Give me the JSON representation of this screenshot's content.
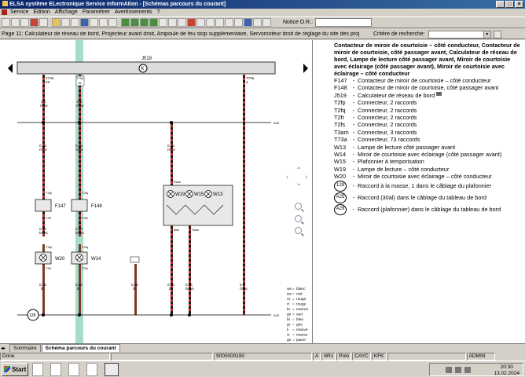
{
  "window": {
    "title": "ELSA système ELectronique Service informAtion - [Schémas parcours du courant]",
    "buttons": [
      "_",
      "□",
      "×"
    ]
  },
  "menu": [
    "Service",
    "Edition",
    "Affichage",
    "Paramétrer",
    "Avertissements",
    "?"
  ],
  "toolbar": {
    "notice_label": "Notice O.R.:",
    "notice_value": ""
  },
  "pagebar": {
    "description": "Page 11: Calculateur de réseau de bord, Projecteur avant droit, Ampoule de feu stop supplémentaire, Servomoteur droit de réglage du site des projecteurs, Éclaireur droit de",
    "search_label": "Critère de recherche:",
    "search_value": ""
  },
  "diagram": {
    "module": "J519",
    "module_symbol": "K",
    "pins": [
      "T73a 48",
      "T73a 15",
      "T73a 4"
    ],
    "pin_top": [
      "T73a",
      "T73a",
      "T73a"
    ],
    "pin_bottom": [
      "48",
      "15",
      "4"
    ],
    "wire_specs": [
      "1.0 rt/sw",
      "0.5 rt/sw",
      "0.35 rt/sw",
      "0.35 rt/sw",
      "0.35 rt/sw",
      "0.35 br/ws",
      "0.35 br/ws",
      "0.35 br",
      "0.35 br",
      "0.35 br",
      "0.35 br",
      "0.35 br/ws",
      "0.35 br/ws",
      "0.5 rt/sw"
    ],
    "wire_gauges": [
      "1.0",
      "0.5",
      "0.35",
      "0.35",
      "0.35",
      "0.35",
      "0.35",
      "0.35",
      "0.35",
      "0.35",
      "0.35",
      "0.35",
      "0.35",
      "0.5"
    ],
    "wire_colors": [
      "rt/sw",
      "rt/sw",
      "rt/sw",
      "rt/sw",
      "rt/sw",
      "br/ws",
      "br/ws",
      "br",
      "br",
      "br",
      "br",
      "br/ws",
      "br/ws",
      "rt/sw"
    ],
    "connectors": [
      "T2fp",
      "T2fq",
      "T2fr",
      "T2fs",
      "T2fp",
      "T2fq",
      "T2fr",
      "T2fs",
      "T3am",
      "T3am",
      "T3am"
    ],
    "components": [
      "F147",
      "F148",
      "W20",
      "W14",
      "W19",
      "W15",
      "W13"
    ],
    "bus": [
      "A25",
      "A29"
    ],
    "ground": "128",
    "color_key": [
      {
        "code": "ws",
        "name": "blanc"
      },
      {
        "code": "sw",
        "name": "noir"
      },
      {
        "code": "ro",
        "name": "rouge"
      },
      {
        "code": "rt",
        "name": "rouge"
      },
      {
        "code": "br",
        "name": "marron"
      },
      {
        "code": "gn",
        "name": "vert"
      },
      {
        "code": "bl",
        "name": "bleu"
      },
      {
        "code": "gr",
        "name": "gris"
      },
      {
        "code": "li",
        "name": "mauve"
      },
      {
        "code": "vi",
        "name": "mauve"
      },
      {
        "code": "ge",
        "name": "jaune"
      }
    ],
    "colors": {
      "wire_red": "#c0302a",
      "wire_dark": "#1a1a1a",
      "highlight": "#a7dcc9"
    }
  },
  "legend": {
    "title": "Contacteur de miroir de courtoisie – côté conducteur, Contacteur de miroir de courtoisie, côté passager avant, Calculateur de réseau de bord, Lampe de lecture côté passager avant, Miroir de courtoisie avec éclairage (côté passager avant), Miroir de courtoisie avec éclairage – côté conducteur",
    "items": [
      {
        "code": "F147",
        "text": "Contacteur de miroir de courtoisie – côté conducteur"
      },
      {
        "code": "F148",
        "text": "Contacteur de miroir de courtoisie, côté passager avant"
      },
      {
        "code": "J519",
        "text": "Calculateur de réseau de bord"
      },
      {
        "code": "T2fp",
        "text": "Connecteur, 2 raccords"
      },
      {
        "code": "T2fq",
        "text": "Connecteur, 2 raccords"
      },
      {
        "code": "T2fr",
        "text": "Connecteur, 2 raccords"
      },
      {
        "code": "T2fs",
        "text": "Connecteur, 2 raccords"
      },
      {
        "code": "T3am",
        "text": "Connecteur, 3 raccords"
      },
      {
        "code": "T73a",
        "text": "Connecteur, 73 raccords"
      },
      {
        "code": "W13",
        "text": "Lampe de lecture côté passager avant"
      },
      {
        "code": "W14",
        "text": "Miroir de courtoisie avec éclairage (côté passager avant)"
      },
      {
        "code": "W15",
        "text": "Plafonnier à temporisation"
      },
      {
        "code": "W19",
        "text": "Lampe de lecture – côté conducteur"
      },
      {
        "code": "W20",
        "text": "Miroir de courtoisie avec éclairage – côté conducteur"
      }
    ],
    "circle_items": [
      {
        "code": "128",
        "text": "Raccord à la masse, 1 dans le câblage du plafonnier"
      },
      {
        "code": "A25",
        "text": "Raccord (30al) dans le câblage du tableau de bord"
      },
      {
        "code": "A29",
        "text": "Raccord (plafonnier) dans le câblage du tableau de bord"
      }
    ]
  },
  "tabs": [
    {
      "label": "Sommaire",
      "active": false
    },
    {
      "label": "Schéma parcours du courant",
      "active": true
    }
  ],
  "status": {
    "left": "Done",
    "code": "9000000190",
    "fields": [
      "A",
      "6R1",
      "Polo",
      "CAYC",
      "KFK"
    ],
    "user": "ADMIN"
  },
  "taskbar": {
    "start": "Start",
    "time": "20:30",
    "date": "13.02.2024"
  }
}
